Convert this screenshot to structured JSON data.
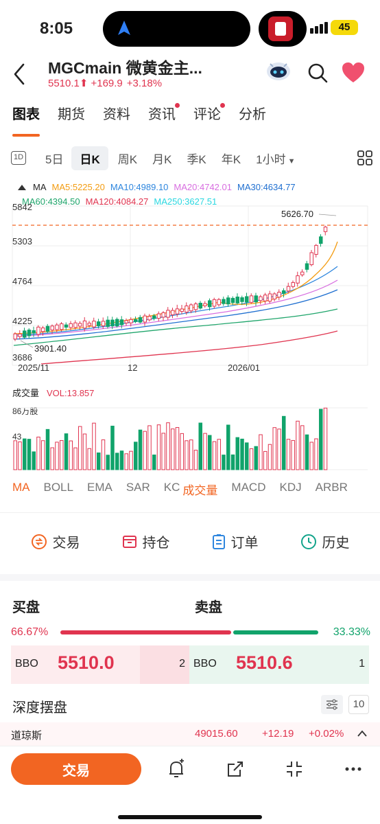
{
  "status_bar": {
    "time": "8:05",
    "battery": "45"
  },
  "header": {
    "title": "MGCmain  微黄金主...",
    "price": "5510.1",
    "change": "+169.9",
    "change_pct": "+3.18%"
  },
  "tabs": [
    {
      "label": "图表",
      "active": true,
      "dot": false
    },
    {
      "label": "期货",
      "active": false,
      "dot": false
    },
    {
      "label": "资料",
      "active": false,
      "dot": false
    },
    {
      "label": "资讯",
      "active": false,
      "dot": true
    },
    {
      "label": "评论",
      "active": false,
      "dot": true
    },
    {
      "label": "分析",
      "active": false,
      "dot": false
    }
  ],
  "periods": [
    "1D",
    "5日",
    "日K",
    "周K",
    "月K",
    "季K",
    "年K",
    "1小时"
  ],
  "ma_legend": {
    "label": "MA",
    "items": [
      {
        "text": "MA5:5225.20",
        "color": "#f39c12"
      },
      {
        "text": "MA10:4989.10",
        "color": "#2e86de"
      },
      {
        "text": "MA20:4742.01",
        "color": "#d86ee0"
      },
      {
        "text": "MA30:4634.77",
        "color": "#1f6fd0"
      },
      {
        "text": "MA60:4394.50",
        "color": "#1fa56b"
      },
      {
        "text": "MA120:4084.27",
        "color": "#e0344f"
      },
      {
        "text": "MA250:3627.51",
        "color": "#2ad7e0"
      }
    ]
  },
  "chart_data": {
    "type": "candlestick",
    "y_ticks": [
      "5842",
      "5303",
      "4764",
      "4225",
      "3686"
    ],
    "ylim": [
      3686,
      5842
    ],
    "x_ticks": [
      "2025/11",
      "12",
      "2026/01"
    ],
    "high_label": "5626.70",
    "low_label": "3901.40",
    "volume_title": "成交量",
    "volume_label": "VOL:13.857",
    "volume_ticks": [
      "86万股",
      "43"
    ]
  },
  "indicator_tabs": [
    "MA",
    "BOLL",
    "EMA",
    "SAR",
    "KC",
    "成交量",
    "MACD",
    "KDJ",
    "ARBR"
  ],
  "actions": [
    "交易",
    "持仓",
    "订单",
    "历史"
  ],
  "orderbook": {
    "buy_title": "买盘",
    "sell_title": "卖盘",
    "buy_pct": "66.67%",
    "sell_pct": "33.33%",
    "buy_fraction": 0.6667,
    "bbo_label": "BBO",
    "bid_price": "5510.0",
    "bid_qty": "2",
    "ask_price": "5510.6",
    "ask_qty": "1",
    "depth_label": "深度摆盘",
    "depth_num": "10"
  },
  "ticker": {
    "name": "道琼斯",
    "value": "49015.60",
    "change": "+12.19",
    "change_pct": "+0.02%"
  },
  "bottom": {
    "trade_label": "交易"
  }
}
